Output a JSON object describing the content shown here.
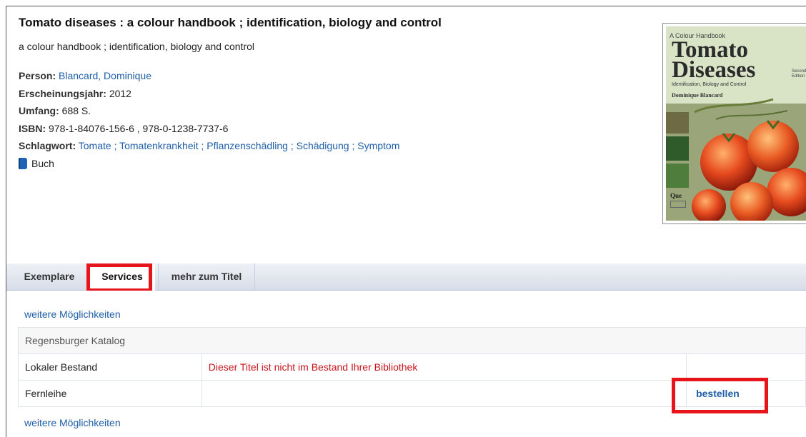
{
  "record": {
    "title": "Tomato diseases :  a colour handbook ; identification, biology and control",
    "subtitle": "a colour handbook ; identification, biology and control",
    "person_label": "Person:",
    "person": "Blancard, Dominique",
    "year_label": "Erscheinungsjahr:",
    "year": "2012",
    "extent_label": "Umfang:",
    "extent": "688 S.",
    "isbn_label": "ISBN:",
    "isbn": "978-1-84076-156-6 , 978-0-1238-7737-6",
    "subjects_label": "Schlagwort:",
    "subjects": [
      "Tomate",
      "Tomatenkrankheit",
      "Pflanzenschädling",
      "Schädigung",
      "Symptom"
    ],
    "subject_separator": " ; ",
    "media_icon": "book-icon",
    "media_type": "Buch"
  },
  "cover": {
    "series": "A Colour Handbook",
    "title_line1": "Tomato",
    "title_line2": "Diseases",
    "edition": "Second Edition",
    "subtitle": "Identification, Biology and Control",
    "author": "Dominique Blancard",
    "publisher": "Que"
  },
  "tabs": [
    {
      "label": "Exemplare"
    },
    {
      "label": "Services"
    },
    {
      "label": "mehr zum Titel"
    }
  ],
  "services": {
    "more_link_top": "weitere Möglichkeiten",
    "more_link_bottom": "weitere Möglichkeiten",
    "catalog_header": "Regensburger Katalog",
    "rows": [
      {
        "label": "Lokaler Bestand",
        "status": "Dieser Titel ist nicht im Bestand Ihrer Bibliothek",
        "action": ""
      },
      {
        "label": "Fernleihe",
        "status": "",
        "action": "bestellen"
      }
    ]
  },
  "colors": {
    "link": "#1f5ea8",
    "highlight": "#e8141c",
    "warning": "#c8131b"
  }
}
